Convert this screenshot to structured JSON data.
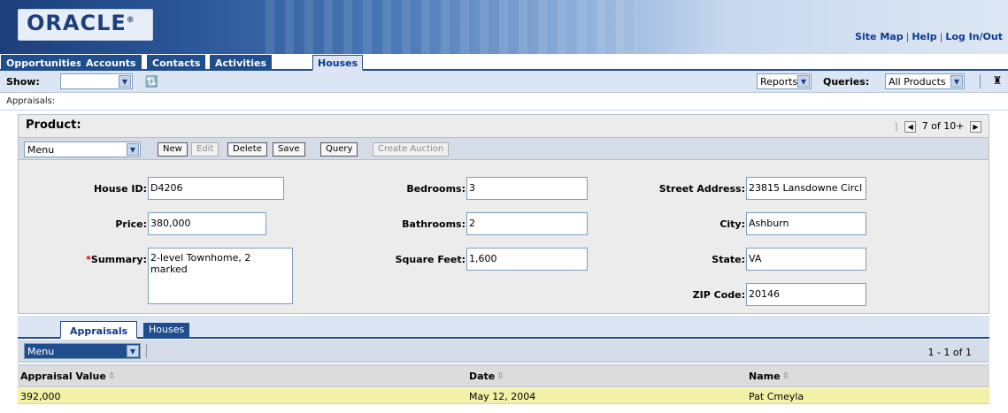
{
  "brand": {
    "logo": "ORACLE",
    "logo_mark": "®"
  },
  "top_links": [
    "Site Map",
    "Help",
    "Log In/Out"
  ],
  "tabs": [
    {
      "label": "Opportunities"
    },
    {
      "label": "Accounts"
    },
    {
      "label": "Contacts"
    },
    {
      "label": "Activities"
    },
    {
      "label": "Houses"
    }
  ],
  "showbar": {
    "show_label": "Show:",
    "show_value": "",
    "reports_label": "Reports",
    "queries_label": "Queries:",
    "queries_value": "All Products"
  },
  "breadcrumb": "Appraisals:",
  "product": {
    "title": "Product:",
    "pager": "7 of 10+",
    "menu_value": "Menu",
    "buttons": {
      "new": "New",
      "edit": "Edit",
      "delete": "Delete",
      "save": "Save",
      "query": "Query",
      "create_auction": "Create Auction"
    },
    "fields": {
      "house_id": {
        "label": "House ID:",
        "value": "D4206"
      },
      "price": {
        "label": "Price:",
        "value": "380,000"
      },
      "summary": {
        "label": "Summary:",
        "required": "*",
        "value": "2-level Townhome, 2 marked"
      },
      "bedrooms": {
        "label": "Bedrooms:",
        "value": "3"
      },
      "bathrooms": {
        "label": "Bathrooms:",
        "value": "2"
      },
      "square_feet": {
        "label": "Square Feet:",
        "value": "1,600"
      },
      "street": {
        "label": "Street Address:",
        "value": "23815 Lansdowne Circl"
      },
      "city": {
        "label": "City:",
        "value": "Ashburn"
      },
      "state": {
        "label": "State:",
        "value": "VA"
      },
      "zip": {
        "label": "ZIP Code:",
        "value": "20146"
      }
    }
  },
  "subtabs": {
    "active": "Appraisals",
    "inactive": "Houses"
  },
  "list": {
    "menu_value": "Menu",
    "count": "1 - 1 of 1",
    "columns": [
      "Appraisal Value",
      "Date",
      "Name"
    ],
    "rows": [
      {
        "appraisal_value": "392,000",
        "date": "May 12, 2004",
        "name": "Pat Cmeyla"
      }
    ]
  },
  "colors": {
    "brand_blue": "#1f4d8d",
    "panel_bg": "#ececec",
    "row_highlight": "#f3f1a8"
  }
}
